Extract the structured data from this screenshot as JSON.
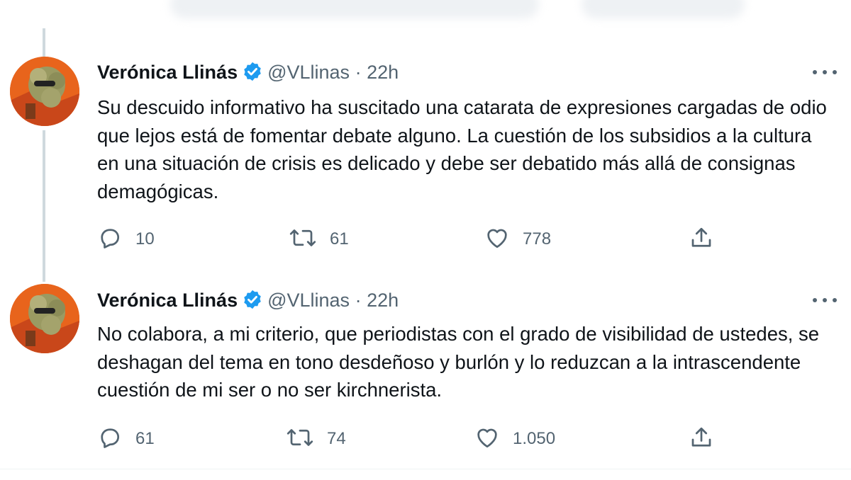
{
  "tweets": [
    {
      "name": "Verónica Llinás",
      "handle": "@VLlinas",
      "dot": "·",
      "time": "22h",
      "text": "Su descuido informativo ha suscitado una catarata de expresiones cargadas de odio que lejos está de fomentar debate alguno. La cuestión de los subsidios a la cultura en una situación de crisis es delicado y debe ser debatido más allá de consignas demagógicas.",
      "replies": "10",
      "retweets": "61",
      "likes": "778"
    },
    {
      "name": "Verónica Llinás",
      "handle": "@VLlinas",
      "dot": "·",
      "time": "22h",
      "text": "No colabora, a mi criterio, que periodistas con el grado de visibilidad de ustedes, se deshagan del tema en tono desdeñoso y burlón y lo reduzcan a la intrascendente cuestión de mi ser o no ser kirchnerista.",
      "replies": "61",
      "retweets": "74",
      "likes": "1.050"
    }
  ],
  "colors": {
    "text": "#0f1419",
    "secondary": "#536471",
    "verified": "#1d9bf0",
    "thread_line": "#cfd9de",
    "avatar_bg": "#e8641c"
  },
  "icons": [
    "verified-badge-icon",
    "more-icon",
    "reply-icon",
    "retweet-icon",
    "like-icon",
    "share-icon"
  ]
}
